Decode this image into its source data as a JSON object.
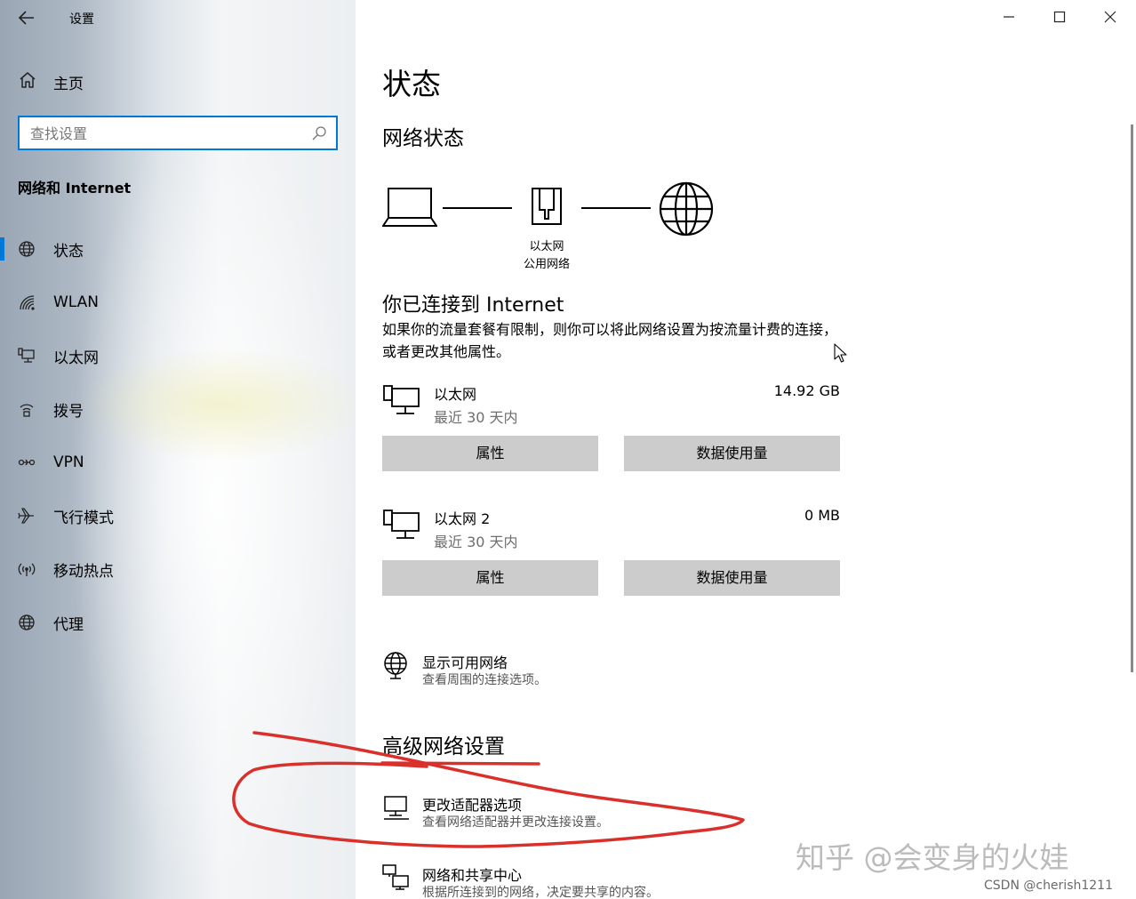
{
  "window": {
    "title": "设置"
  },
  "sidebar": {
    "home_label": "主页",
    "search_placeholder": "查找设置",
    "section_title": "网络和 Internet",
    "items": [
      {
        "label": "状态",
        "icon": "status-globe-icon",
        "active": true
      },
      {
        "label": "WLAN",
        "icon": "wifi-icon"
      },
      {
        "label": "以太网",
        "icon": "ethernet-icon"
      },
      {
        "label": "拨号",
        "icon": "dialup-icon"
      },
      {
        "label": "VPN",
        "icon": "vpn-icon"
      },
      {
        "label": "飞行模式",
        "icon": "airplane-icon"
      },
      {
        "label": "移动热点",
        "icon": "hotspot-icon"
      },
      {
        "label": "代理",
        "icon": "proxy-globe-icon"
      }
    ]
  },
  "main": {
    "title": "状态",
    "network_status_heading": "网络状态",
    "diagram": {
      "adapter_name": "以太网",
      "network_type": "公用网络"
    },
    "connected_title": "你已连接到 Internet",
    "connected_desc": "如果你的流量套餐有限制，则你可以将此网络设置为按流量计费的连接，或者更改其他属性。",
    "adapters": [
      {
        "name": "以太网",
        "period": "最近 30 天内",
        "usage": "14.92 GB",
        "properties_label": "属性",
        "data_usage_label": "数据使用量"
      },
      {
        "name": "以太网 2",
        "period": "最近 30 天内",
        "usage": "0 MB",
        "properties_label": "属性",
        "data_usage_label": "数据使用量"
      }
    ],
    "show_networks": {
      "title": "显示可用网络",
      "subtitle": "查看周围的连接选项。"
    },
    "advanced_heading": "高级网络设置",
    "advanced_links": [
      {
        "title": "更改适配器选项",
        "subtitle": "查看网络适配器并更改连接设置。"
      },
      {
        "title": "网络和共享中心",
        "subtitle": "根据所连接到的网络，决定要共享的内容。"
      }
    ]
  },
  "overlay": {
    "watermark": "知乎 @会变身的火娃",
    "credit": "CSDN @cherish1211"
  },
  "colors": {
    "accent": "#0078d7",
    "button_bg": "#cccccc",
    "annotation_red": "#d9302b"
  }
}
